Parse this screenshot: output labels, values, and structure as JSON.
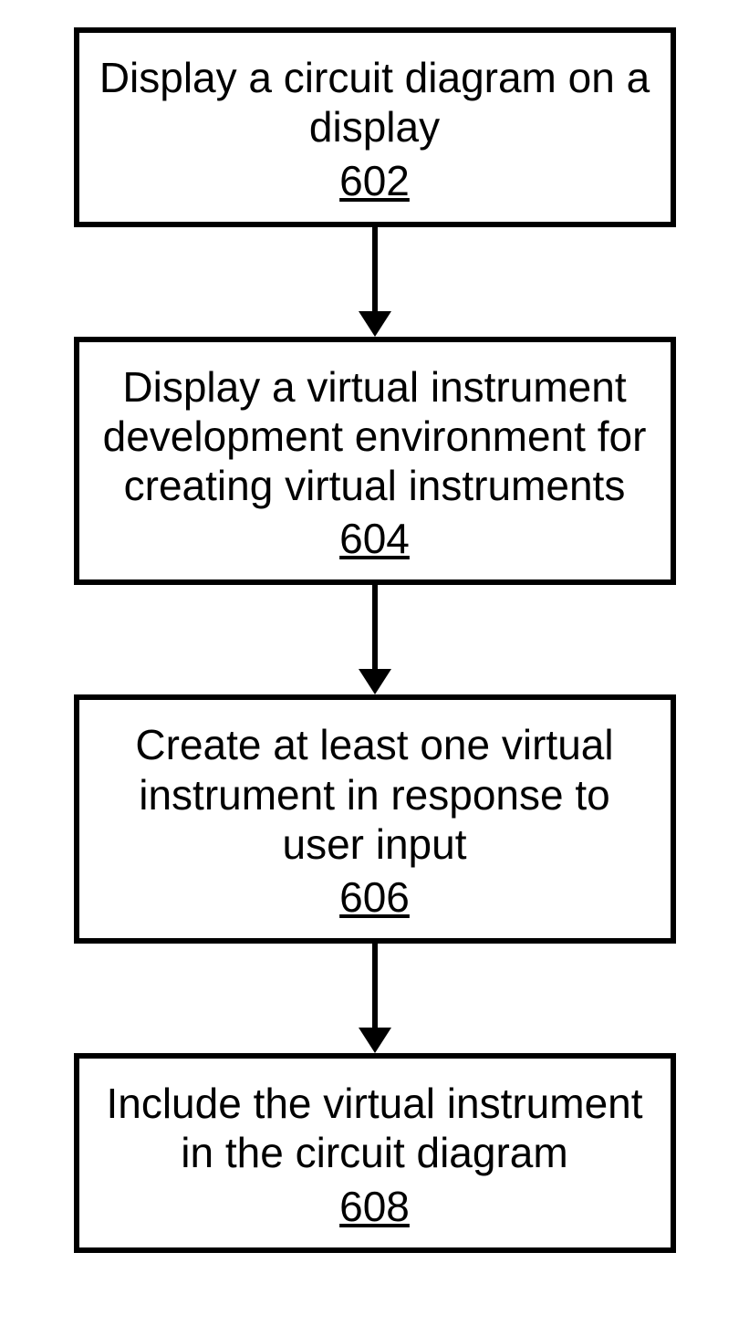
{
  "flowchart": {
    "steps": [
      {
        "text": "Display a circuit diagram on a display",
        "ref": "602"
      },
      {
        "text": "Display a virtual instrument development environment for creating virtual instruments",
        "ref": "604"
      },
      {
        "text": "Create at least one virtual instrument in response to user input",
        "ref": "606"
      },
      {
        "text": "Include the virtual instrument in the circuit diagram",
        "ref": "608"
      }
    ]
  }
}
